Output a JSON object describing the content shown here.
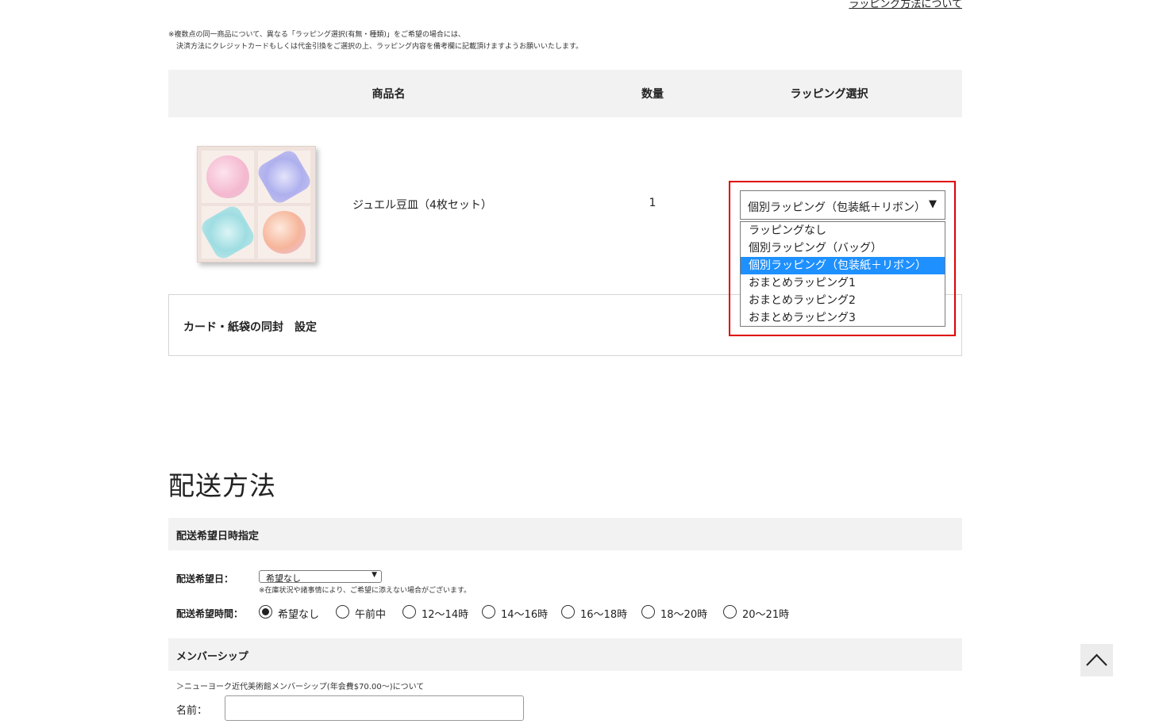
{
  "top_link": "ラッピング方法について",
  "note": {
    "line1": "※複数点の同一商品について、異なる「ラッピング選択(有無・種類)」をご希望の場合には、",
    "line2": "決済方法にクレジットカードもしくは代金引換をご選択の上、ラッピング内容を備考欄に記載頂けますようお願いいたします。"
  },
  "product_table": {
    "headers": [
      "商品名",
      "数量",
      "ラッピング選択"
    ],
    "rows": [
      {
        "image_icon": "plate-set-image",
        "name": "ジュエル豆皿（4枚セット）",
        "quantity": "1",
        "wrapping_selected": "個別ラッピング（包装紙＋リボン）",
        "wrapping_options": [
          "ラッピングなし",
          "個別ラッピング（バッグ）",
          "個別ラッピング（包装紙＋リボン）",
          "おまとめラッピング1",
          "おまとめラッピング2",
          "おまとめラッピング3"
        ],
        "selected_index": 2
      }
    ]
  },
  "card_section": {
    "title": "カード・紙袋の同封　設定"
  },
  "shipping": {
    "title": "配送方法",
    "delivery_bar": "配送希望日時指定",
    "date_label": "配送希望日：",
    "date_value": "希望なし",
    "date_note": "※在庫状況や諸事情により、ご希望に添えない場合がございます。",
    "time_label": "配送希望時間：",
    "time_options": [
      "希望なし",
      "午前中",
      "12～14時",
      "14～16時",
      "16～18時",
      "18～20時",
      "20～21時"
    ],
    "time_selected": 0
  },
  "membership": {
    "bar": "メンバーシップ",
    "link": "＞ニューヨーク近代美術館メンバーシップ(年会費$70.00～)について",
    "name_label": "名前：",
    "name_value": ""
  },
  "colors": {
    "header_bg": "#f2f2f2",
    "highlight": "#e00000",
    "option_selected": "#1e90ff"
  },
  "icons": {
    "dropdown_arrow": "▼",
    "scroll_top": "chevron-up-icon"
  }
}
